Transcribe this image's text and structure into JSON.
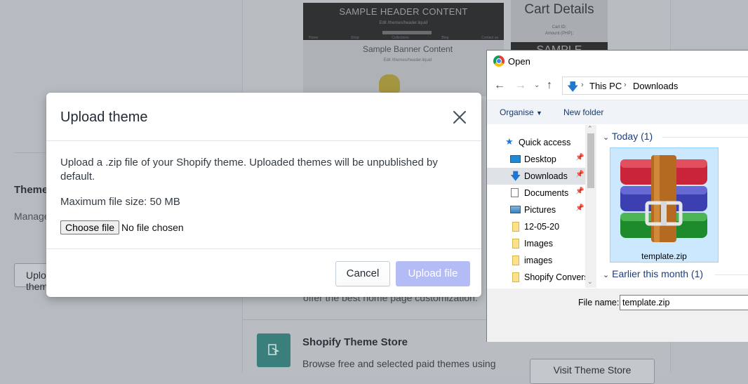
{
  "background": {
    "themes_title": "Themes",
    "themes_desc": "Manage themes appearance",
    "upload_btn": "Upload theme",
    "preview": {
      "header_title": "SAMPLE HEADER CONTENT",
      "header_sub": "Edit /themes/header.liquid",
      "nav": [
        "Home",
        "Shop",
        "Collections",
        "Blog",
        "Contact us"
      ],
      "banner_title": "Sample Banner Content",
      "banner_sub": "Edit /themes/header.liquid",
      "cart_title": "Cart Details",
      "cart_line1": "Cart ID:",
      "cart_line2": "Amount (PHP):",
      "cart_dark": "SAMPLE"
    },
    "offer_text": "offer the best home page customization.",
    "store_title": "Shopify Theme Store",
    "store_desc": "Browse free and selected paid themes using",
    "visit_btn": "Visit Theme Store"
  },
  "modal": {
    "title": "Upload theme",
    "description": "Upload a .zip file of your Shopify theme. Uploaded themes will be unpublished by default.",
    "max_size": "Maximum file size: 50 MB",
    "choose_file": "Choose file",
    "no_file": "No file chosen",
    "cancel": "Cancel",
    "upload": "Upload file"
  },
  "dialog": {
    "title": "Open",
    "breadcrumb": [
      "This PC",
      "Downloads"
    ],
    "organise": "Organise",
    "new_folder": "New folder",
    "nav_items": [
      {
        "label": "Quick access",
        "icon": "star-icon"
      },
      {
        "label": "Desktop",
        "icon": "desktop-icon",
        "pinned": true
      },
      {
        "label": "Downloads",
        "icon": "download-icon",
        "pinned": true,
        "selected": true
      },
      {
        "label": "Documents",
        "icon": "document-icon",
        "pinned": true
      },
      {
        "label": "Pictures",
        "icon": "pictures-icon",
        "pinned": true
      },
      {
        "label": "12-05-20",
        "icon": "folder-icon"
      },
      {
        "label": "Images",
        "icon": "folder-icon"
      },
      {
        "label": "images",
        "icon": "folder-icon"
      },
      {
        "label": "Shopify Convers",
        "icon": "folder-icon"
      }
    ],
    "group_today": "Today (1)",
    "group_earlier": "Earlier this month (1)",
    "file": {
      "name": "template.zip",
      "icon": "winrar-archive-icon"
    },
    "filename_label": "File name:",
    "filename_value": "template.zip"
  }
}
